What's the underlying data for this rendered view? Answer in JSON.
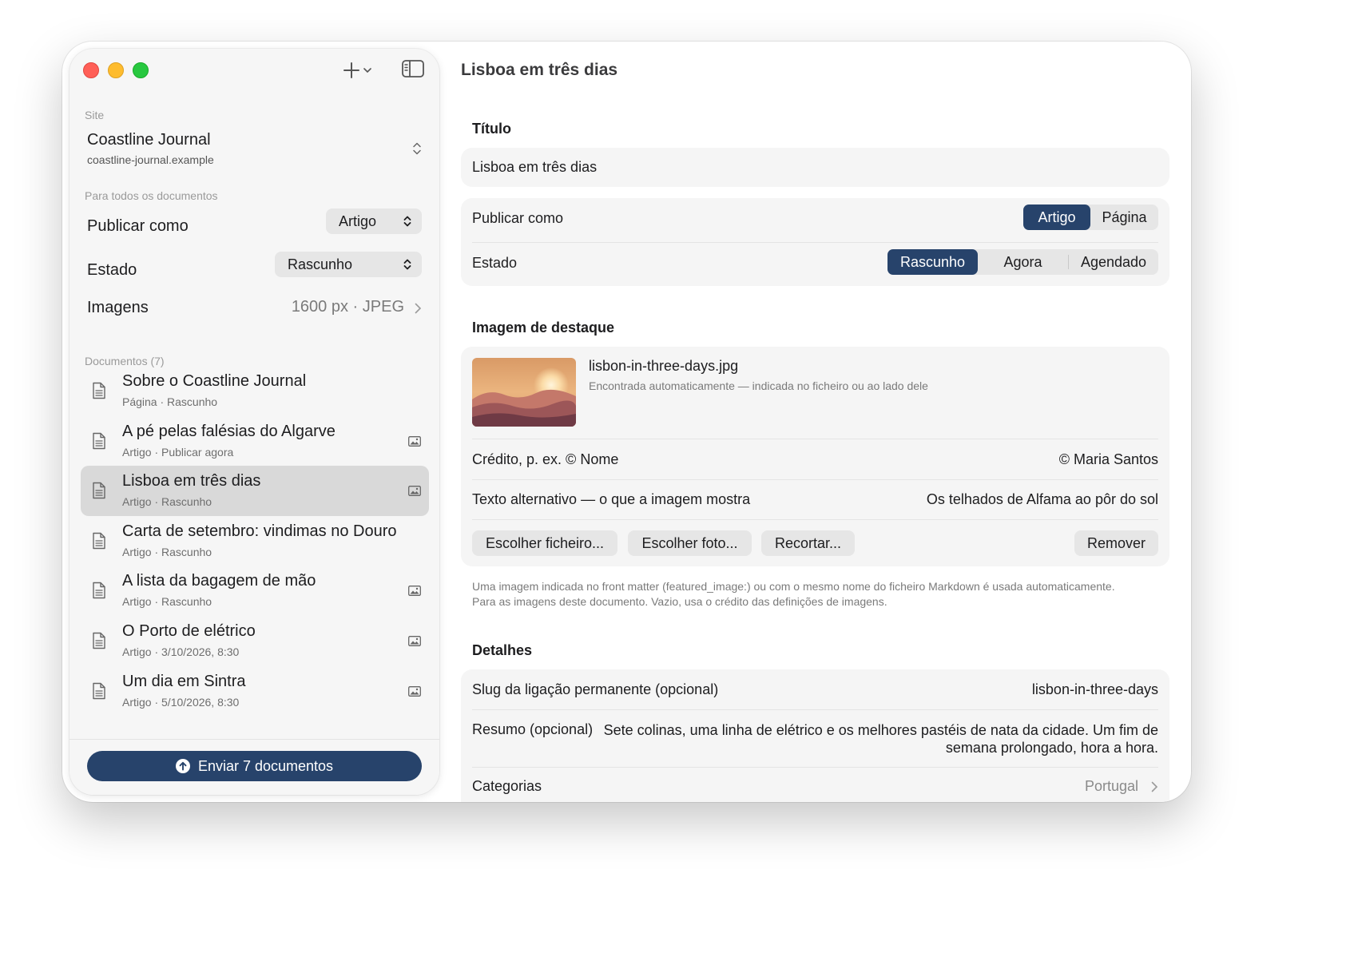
{
  "sidebar": {
    "site_section_label": "Site",
    "site_name": "Coastline Journal",
    "site_url": "coastline-journal.example",
    "all_docs_label": "Para todos os documentos",
    "publish_as_label": "Publicar como",
    "publish_as_value": "Artigo",
    "state_label": "Estado",
    "state_value": "Rascunho",
    "images_label": "Imagens",
    "images_value": "1600 px · JPEG",
    "documents_label": "Documentos (7)",
    "documents": [
      {
        "title": "Sobre o Coastline Journal",
        "subtitle": "Página · Rascunho",
        "has_image": false,
        "selected": false
      },
      {
        "title": "A pé pelas falésias do Algarve",
        "subtitle": "Artigo · Publicar agora",
        "has_image": true,
        "selected": false
      },
      {
        "title": "Lisboa em três dias",
        "subtitle": "Artigo · Rascunho",
        "has_image": true,
        "selected": true
      },
      {
        "title": "Carta de setembro: vindimas no Douro",
        "subtitle": "Artigo · Rascunho",
        "has_image": false,
        "selected": false
      },
      {
        "title": "A lista da bagagem de mão",
        "subtitle": "Artigo · Rascunho",
        "has_image": true,
        "selected": false
      },
      {
        "title": "O Porto de elétrico",
        "subtitle": "Artigo · 3/10/2026, 8:30",
        "has_image": true,
        "selected": false
      },
      {
        "title": "Um dia em Sintra",
        "subtitle": "Artigo · 5/10/2026, 8:30",
        "has_image": true,
        "selected": false
      }
    ],
    "send_button": "Enviar 7 documentos"
  },
  "main": {
    "window_title": "Lisboa em três dias",
    "title_section": "Título",
    "title_value": "Lisboa em três dias",
    "publish_as_label": "Publicar como",
    "publish_as_options": [
      "Artigo",
      "Página"
    ],
    "publish_as_selected": "Artigo",
    "state_label": "Estado",
    "state_options": [
      "Rascunho",
      "Agora",
      "Agendado"
    ],
    "state_selected": "Rascunho",
    "featured_section": "Imagem de destaque",
    "featured_filename": "lisbon-in-three-days.jpg",
    "featured_note": "Encontrada automaticamente — indicada no ficheiro ou ao lado dele",
    "credit_label": "Crédito, p. ex. © Nome",
    "credit_value": "© Maria Santos",
    "alt_label": "Texto alternativo — o que a imagem mostra",
    "alt_value": "Os telhados de Alfama ao pôr do sol",
    "btn_choose_file": "Escolher ficheiro...",
    "btn_choose_photo": "Escolher foto...",
    "btn_crop": "Recortar...",
    "btn_remove": "Remover",
    "help_text": "Uma imagem indicada no front matter (featured_image:) ou com o mesmo nome do ficheiro Markdown é usada automaticamente. Para as imagens deste documento. Vazio, usa o crédito das definições de imagens.",
    "details_section": "Detalhes",
    "slug_label": "Slug da ligação permanente (opcional)",
    "slug_value": "lisbon-in-three-days",
    "summary_label": "Resumo (opcional)",
    "summary_value": "Sete colinas, uma linha de elétrico e os melhores pastéis de nata da cidade. Um fim de semana prolongado, hora a hora.",
    "categories_label": "Categorias",
    "categories_value": "Portugal"
  },
  "colors": {
    "accent": "#27436b",
    "close": "#ff5f57",
    "minimize": "#febc2e",
    "zoom": "#28c840"
  }
}
